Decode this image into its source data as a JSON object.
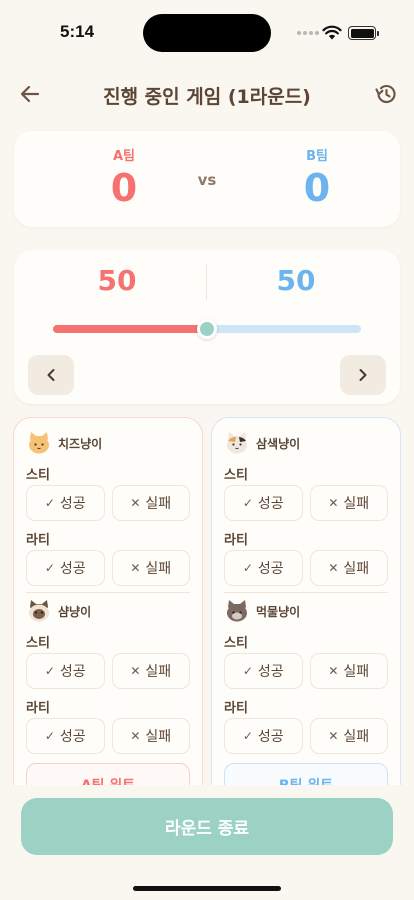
{
  "status_bar": {
    "time": "5:14"
  },
  "header": {
    "title": "진행 중인 게임 (1라운드)",
    "back_icon": "arrow-left-icon",
    "history_icon": "history-icon"
  },
  "scoreboard": {
    "team_a": {
      "label": "A팀",
      "score": "0",
      "color": "#f57271"
    },
    "vs": "vs",
    "team_b": {
      "label": "B팀",
      "score": "0",
      "color": "#6cb4f0"
    }
  },
  "points": {
    "team_a": "50",
    "team_b": "50",
    "slider_fraction": 0.5,
    "prev_icon": "chevron-left-icon",
    "next_icon": "chevron-right-icon"
  },
  "panels": {
    "team_a": {
      "players": [
        {
          "name": "치즈냥이",
          "avatar": "orange-cat-icon",
          "skills": [
            {
              "label": "스티",
              "success": "성공",
              "fail": "실패"
            },
            {
              "label": "라티",
              "success": "성공",
              "fail": "실패"
            }
          ]
        },
        {
          "name": "샴냥이",
          "avatar": "siamese-cat-icon",
          "skills": [
            {
              "label": "스티",
              "success": "성공",
              "fail": "실패"
            },
            {
              "label": "라티",
              "success": "성공",
              "fail": "실패"
            }
          ]
        }
      ],
      "win_button": "A팀 위트"
    },
    "team_b": {
      "players": [
        {
          "name": "삼색냥이",
          "avatar": "calico-cat-icon",
          "skills": [
            {
              "label": "스티",
              "success": "성공",
              "fail": "실패"
            },
            {
              "label": "라티",
              "success": "성공",
              "fail": "실패"
            }
          ]
        },
        {
          "name": "먹물냥이",
          "avatar": "gray-cat-icon",
          "skills": [
            {
              "label": "스티",
              "success": "성공",
              "fail": "실패"
            },
            {
              "label": "라티",
              "success": "성공",
              "fail": "실패"
            }
          ]
        }
      ],
      "win_button": "B팀 위트"
    }
  },
  "success_mark": "✓",
  "fail_mark": "✕",
  "footer": {
    "end_round": "라운드 종료",
    "button_color": "#9bd2c4"
  }
}
